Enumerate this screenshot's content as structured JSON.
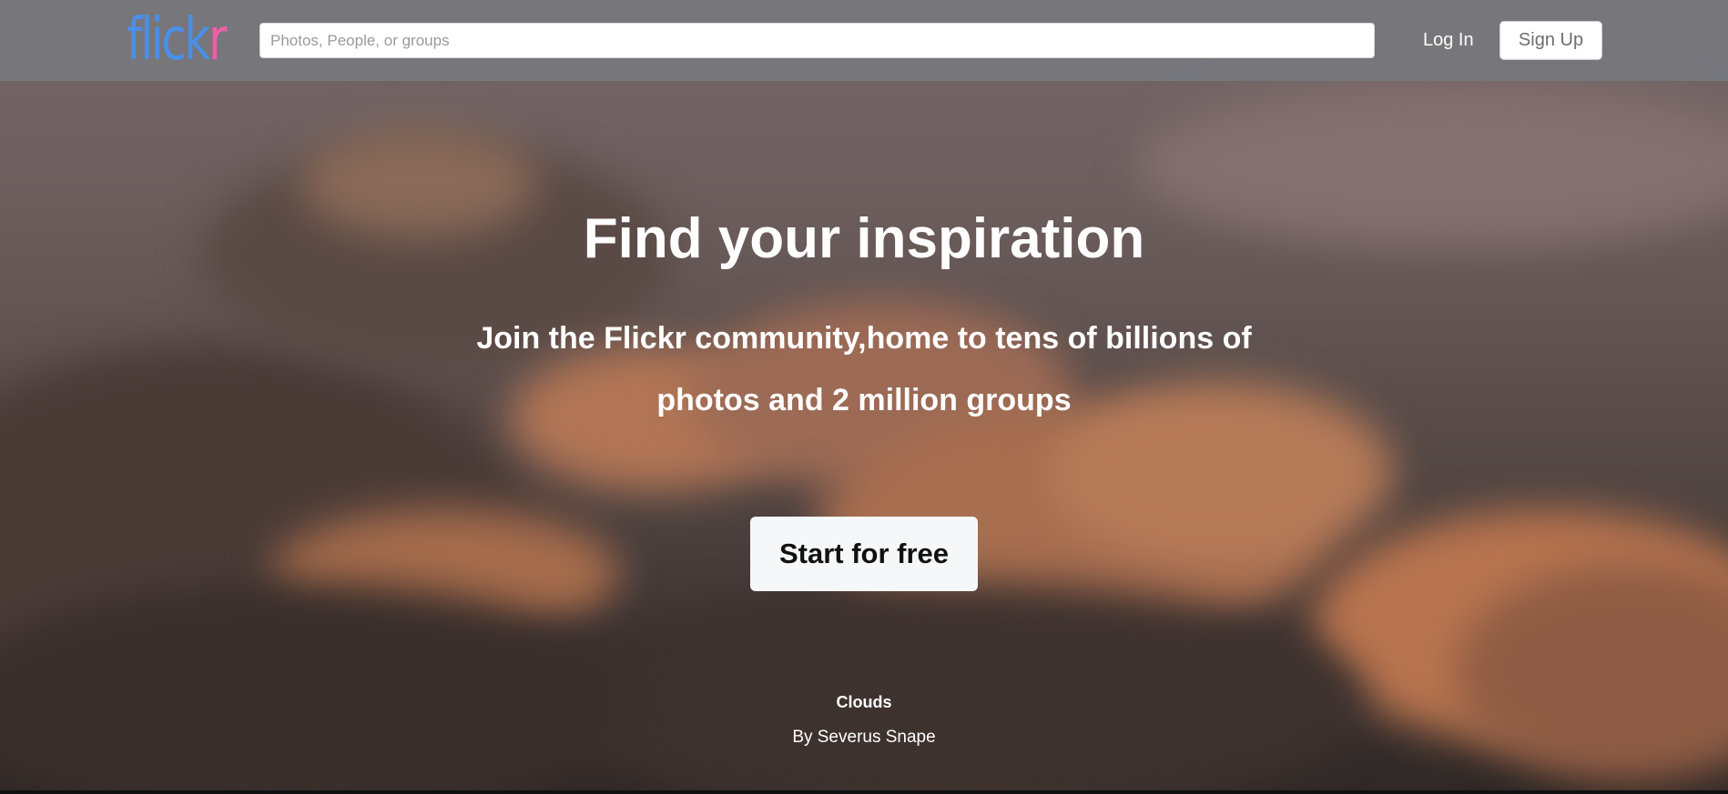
{
  "navbar": {
    "logo_part1": "flick",
    "logo_part2": "r",
    "search_placeholder": "Photos, People, or groups",
    "login_label": "Log In",
    "signup_label": "Sign Up"
  },
  "hero": {
    "title": "Find your inspiration",
    "subtitle": "Join the Flickr community,home to tens of billions of photos and 2 million groups",
    "cta_label": "Start for free",
    "photo_title": "Clouds",
    "photo_author": "By Severus Snape"
  },
  "colors": {
    "logo_blue": "#4a8fe8",
    "logo_pink": "#ee5fa8",
    "navbar_bg": "#76777c",
    "cta_bg": "#f6f7f9"
  }
}
